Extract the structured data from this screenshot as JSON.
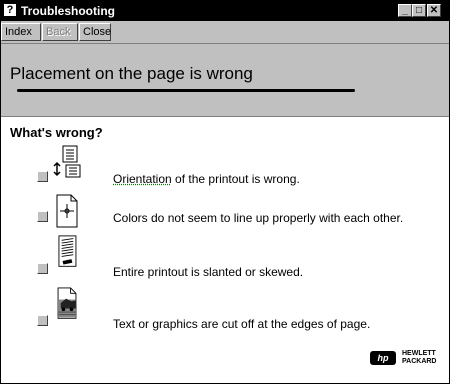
{
  "window": {
    "title": "Troubleshooting",
    "icon": "?",
    "controls": [
      "_",
      "□",
      "✕"
    ]
  },
  "toolbar": {
    "index": "Index",
    "back": "Back",
    "close": "Close"
  },
  "header": {
    "title": "Placement on the page is wrong"
  },
  "question": "What's wrong?",
  "options": [
    {
      "link": "Orientation",
      "text": " of the printout is wrong.",
      "icon": "orientation-icon"
    },
    {
      "link": "",
      "text": "Colors do not seem to line up properly with each other.",
      "icon": "color-alignment-icon"
    },
    {
      "link": "",
      "text": "Entire printout is slanted or skewed.",
      "icon": "skewed-page-icon"
    },
    {
      "link": "",
      "text": "Text or graphics are cut off at the edges of page.",
      "icon": "cutoff-page-icon"
    }
  ],
  "logo": {
    "mark": "hp",
    "line1": "HEWLETT",
    "line2": "PACKARD"
  }
}
